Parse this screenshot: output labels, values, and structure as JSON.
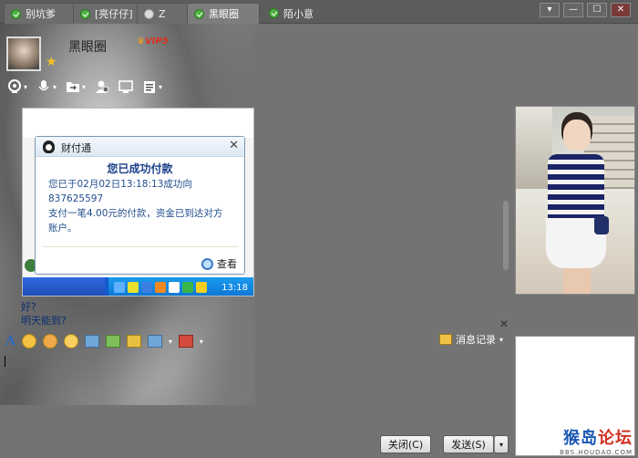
{
  "tabs": [
    {
      "label": "别坑爹",
      "status": "online"
    },
    {
      "label": "[亮仔仔]",
      "status": "online"
    },
    {
      "label": "Z",
      "status": "offline"
    },
    {
      "label": "黑眼圈",
      "status": "online"
    },
    {
      "label": "陌小意",
      "status": "online"
    }
  ],
  "window_controls": {
    "menu": "▾",
    "minimize": "—",
    "maximize": "☐",
    "close": "✕"
  },
  "contact": {
    "name": "黑眼圈",
    "vip": "VIP5"
  },
  "popup": {
    "title": "财付通",
    "heading": "您已成功付款",
    "body_lines": [
      "您已于02月02日13:18:13成功向837625597",
      "支付一笔4.00元的付款，资金已到达对方",
      "账户。"
    ],
    "view_label": "查看"
  },
  "taskbar": {
    "clock": "13:18"
  },
  "messages": [
    {
      "text": "好?"
    },
    {
      "text": "明天能到?"
    }
  ],
  "input_toolbar": {
    "history_label": "消息记录"
  },
  "buttons": {
    "close": "关闭(C)",
    "send": "发送(S)",
    "send_arrow": "▾"
  },
  "watermark": {
    "line1_a": "猴岛",
    "line1_b": "论坛",
    "line2": "BBS.HOUDAO.COM"
  },
  "colors": {
    "accent": "#2a6ac2",
    "link_text": "#234e8c",
    "online": "#4db240"
  }
}
